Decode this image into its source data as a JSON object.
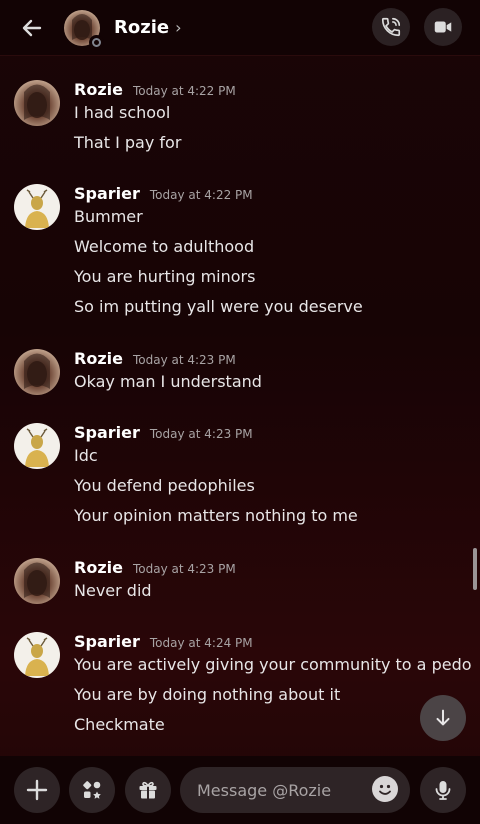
{
  "header": {
    "contact_name": "Rozie",
    "chevron": "›",
    "icons": {
      "back": "arrow-left-icon",
      "call": "phone-call-icon",
      "video": "video-camera-icon"
    }
  },
  "messages": [
    {
      "author": "Rozie",
      "timestamp": "Today at 4:22 PM",
      "lines": [
        "I had school",
        "That I pay for"
      ]
    },
    {
      "author": "Sparier",
      "timestamp": "Today at 4:22 PM",
      "lines": [
        "Bummer",
        "Welcome to adulthood",
        "You are hurting minors",
        "So im putting yall were you deserve"
      ]
    },
    {
      "author": "Rozie",
      "timestamp": "Today at 4:23 PM",
      "lines": [
        "Okay man I understand"
      ]
    },
    {
      "author": "Sparier",
      "timestamp": "Today at 4:23 PM",
      "lines": [
        "Idc",
        "You defend pedophiles",
        "Your opinion matters nothing to me"
      ]
    },
    {
      "author": "Rozie",
      "timestamp": "Today at 4:23 PM",
      "lines": [
        "Never did"
      ]
    },
    {
      "author": "Sparier",
      "timestamp": "Today at 4:24 PM",
      "lines": [
        "You are actively giving your community to a pedo",
        "You are by doing nothing about it",
        "Checkmate"
      ]
    }
  ],
  "composer": {
    "placeholder": "Message @Rozie",
    "icons": {
      "add": "plus-icon",
      "apps": "apps-icon",
      "gift": "gift-icon",
      "emoji": "emoji-icon",
      "voice": "microphone-icon"
    }
  },
  "colors": {
    "background": "#170405",
    "header": "#120304",
    "bubble": "#2e2426",
    "text": "#e8e6e7",
    "timestamp": "#a8a3a4"
  }
}
